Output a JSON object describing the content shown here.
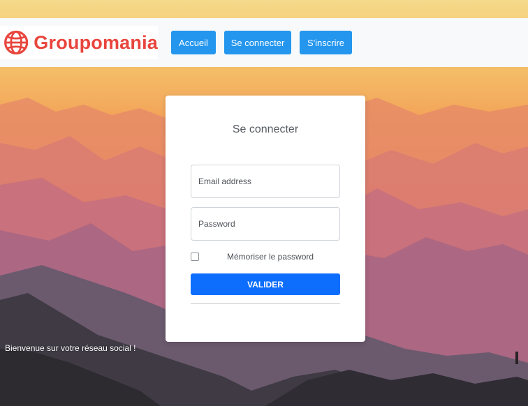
{
  "brand": {
    "name": "Groupomania",
    "logo_icon": "globe-icon",
    "color": "#e8453d"
  },
  "nav": {
    "items": [
      {
        "label": "Accueil"
      },
      {
        "label": "Se connecter"
      },
      {
        "label": "S'inscrire"
      }
    ],
    "button_color": "#2496ee"
  },
  "login": {
    "title": "Se connecter",
    "email_placeholder": "Email address",
    "password_placeholder": "Password",
    "remember_label": "Mémoriser le password",
    "remember_checked": false,
    "submit_label": "VALIDER",
    "submit_color": "#0d6efd"
  },
  "welcome_text": "Bienvenue sur votre réseau social !"
}
